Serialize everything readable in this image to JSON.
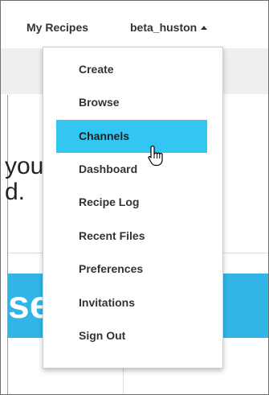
{
  "nav": {
    "my_recipes": "My Recipes",
    "username": "beta_huston"
  },
  "background": {
    "text_line1": "you",
    "text_line2": "d.",
    "banner_text": "se"
  },
  "dropdown": {
    "items": [
      {
        "label": "Create",
        "active": false
      },
      {
        "label": "Browse",
        "active": false
      },
      {
        "label": "Channels",
        "active": true
      },
      {
        "label": "Dashboard",
        "active": false
      },
      {
        "label": "Recipe Log",
        "active": false
      },
      {
        "label": "Recent Files",
        "active": false
      },
      {
        "label": "Preferences",
        "active": false
      },
      {
        "label": "Invitations",
        "active": false
      },
      {
        "label": "Sign Out",
        "active": false
      }
    ]
  },
  "colors": {
    "highlight": "#33c6f3",
    "banner": "#30b5e6"
  },
  "icons": {
    "caret": "caret-up-icon",
    "cursor": "hand-pointer-icon"
  }
}
